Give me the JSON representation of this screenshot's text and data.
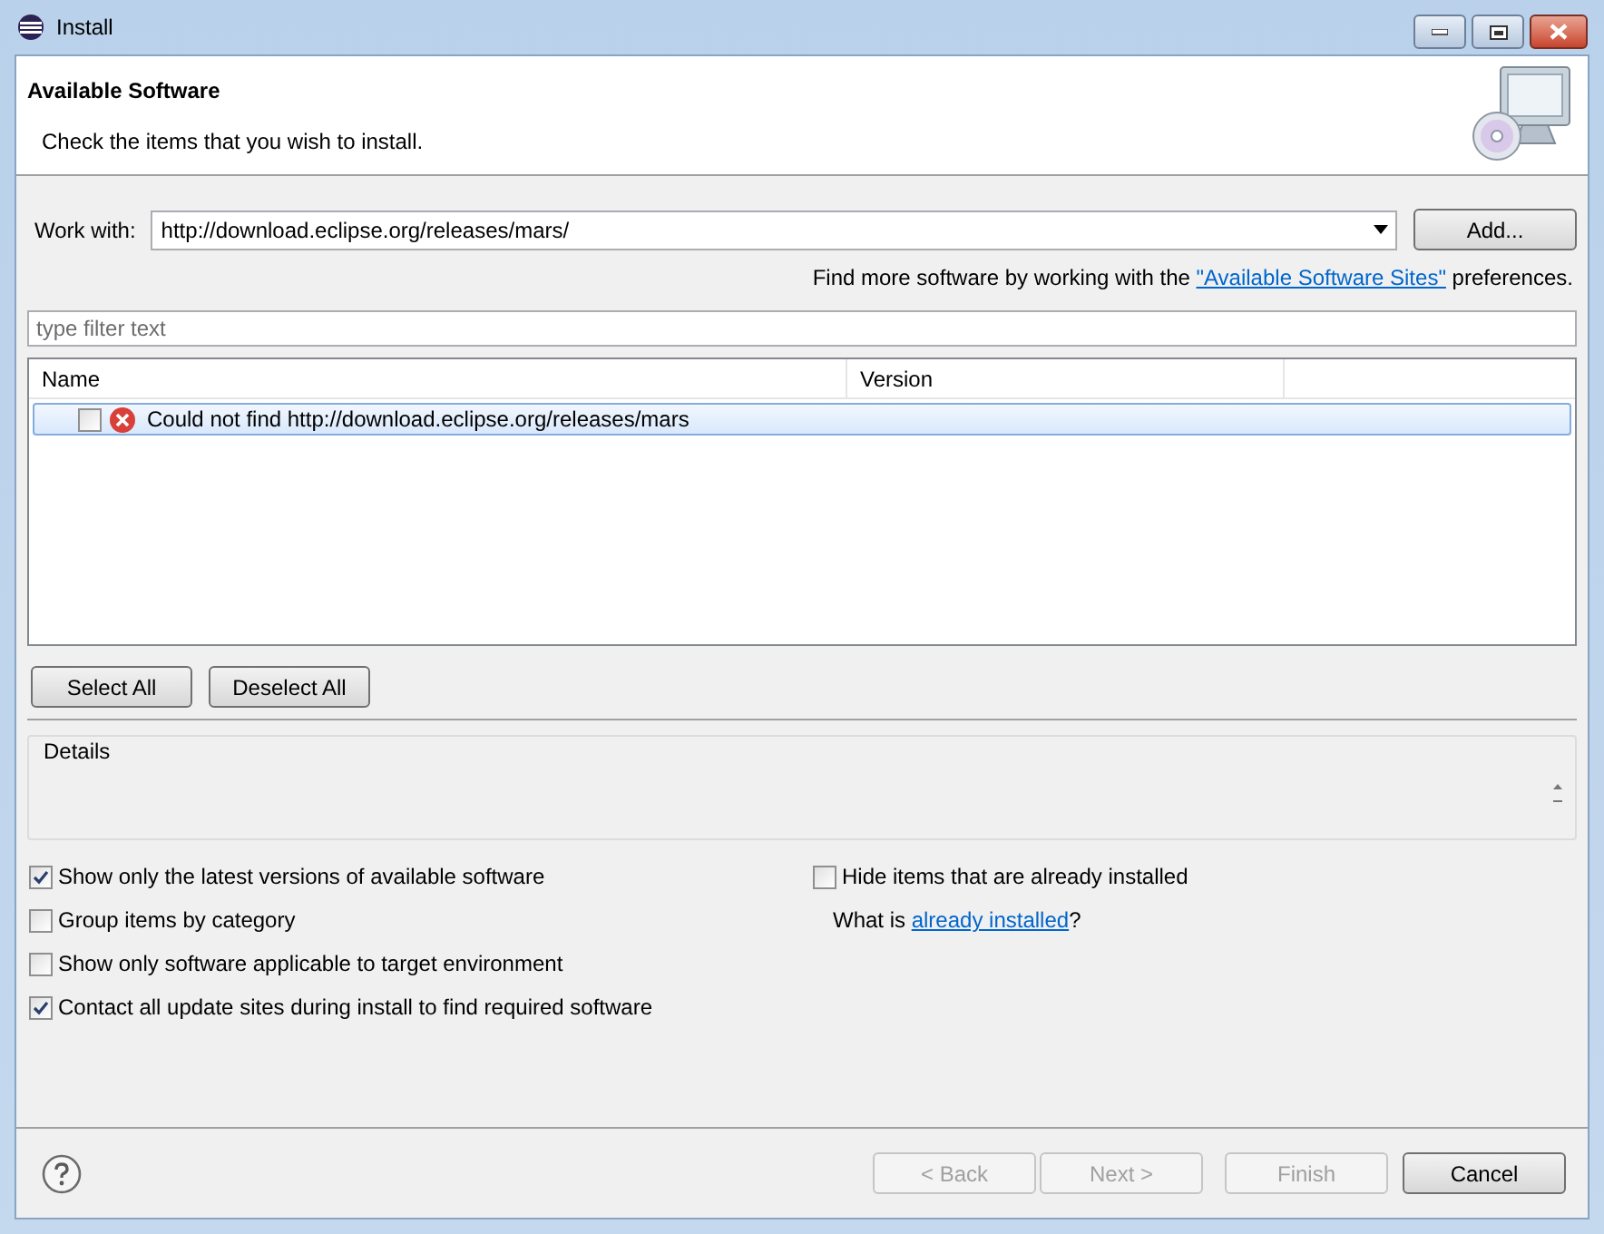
{
  "window": {
    "title": "Install"
  },
  "header": {
    "title": "Available Software",
    "subtitle": "Check the items that you wish to install."
  },
  "work_with": {
    "label": "Work with:",
    "value": "http://download.eclipse.org/releases/mars/",
    "add_button": "Add..."
  },
  "hint": {
    "before": "Find more software by working with the ",
    "link": "\"Available Software Sites\"",
    "after": " preferences."
  },
  "filter": {
    "placeholder": "type filter text"
  },
  "table": {
    "columns": [
      "Name",
      "Version"
    ],
    "rows": [
      {
        "name": "Could not find http://download.eclipse.org/releases/mars",
        "checked": false,
        "kind": "error",
        "selected": true
      }
    ]
  },
  "selection_buttons": [
    "Select All",
    "Deselect All"
  ],
  "details": {
    "title": "Details"
  },
  "options_left": [
    {
      "label": "Show only the latest versions of available software",
      "checked": true
    },
    {
      "label": "Group items by category",
      "checked": false
    },
    {
      "label": "Show only software applicable to target environment",
      "checked": false
    },
    {
      "label": "Contact all update sites during install to find required software",
      "checked": true
    }
  ],
  "options_right": {
    "label": "Hide items that are already installed",
    "checked": false
  },
  "what_is": {
    "before": "What is ",
    "link": "already installed",
    "after": "?"
  },
  "footer": [
    {
      "label": "< Back",
      "disabled": true
    },
    {
      "label": "Next >",
      "disabled": true
    },
    {
      "label": "Finish",
      "disabled": true
    },
    {
      "label": "Cancel",
      "disabled": false
    }
  ]
}
